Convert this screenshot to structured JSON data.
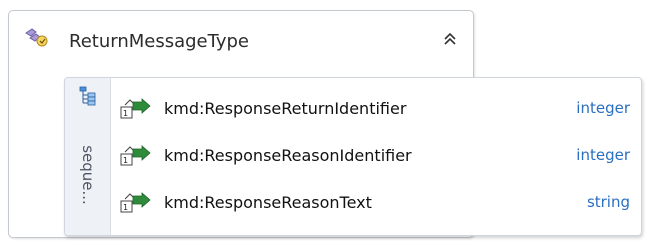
{
  "complex_type": {
    "name": "ReturnMessageType",
    "icon": "complex-type-icon",
    "collapse_icon": "double-chevron-up-icon"
  },
  "compositor": {
    "label": "seque...",
    "icon": "sequence-compositor-icon"
  },
  "elements": [
    {
      "name": "kmd:ResponseReturnIdentifier",
      "type": "integer",
      "icon": "element-icon"
    },
    {
      "name": "kmd:ResponseReasonIdentifier",
      "type": "integer",
      "icon": "element-icon"
    },
    {
      "name": "kmd:ResponseReasonText",
      "type": "string",
      "icon": "element-icon"
    }
  ],
  "colors": {
    "type_text": "#2a6fc0",
    "icon_green": "#2e8b3a",
    "icon_purple": "#7b6bb0"
  }
}
